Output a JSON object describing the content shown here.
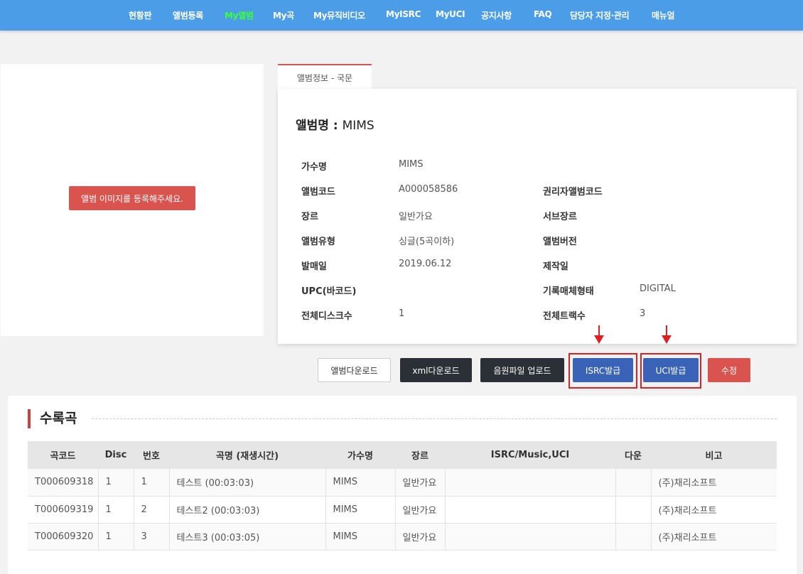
{
  "nav": [
    "현황판",
    "앨범등록",
    "My앨범",
    "My곡",
    "My뮤직비디오",
    "MyISRC",
    "MyUCI",
    "공지사항",
    "FAQ",
    "담당자 지정·관리",
    "매뉴얼"
  ],
  "nav_active": "My앨범",
  "image_panel": {
    "button": "앨범 이미지를 등록해주세요."
  },
  "tab_label": "앨범정보 - 국문",
  "album": {
    "title_label": "앨범명 : ",
    "title_value": "MIMS"
  },
  "info_rows": [
    {
      "l1": "가수명",
      "v1": "MIMS",
      "l2": "",
      "v2": ""
    },
    {
      "l1": "앨범코드",
      "v1": "A000058586",
      "l2": "권리자앨범코드",
      "v2": ""
    },
    {
      "l1": "장르",
      "v1": "일반가요",
      "l2": "서브장르",
      "v2": ""
    },
    {
      "l1": "앨범유형",
      "v1": "싱글(5곡이하)",
      "l2": "앨범버전",
      "v2": ""
    },
    {
      "l1": "발매일",
      "v1": "2019.06.12",
      "l2": "제작일",
      "v2": ""
    },
    {
      "l1": "UPC(바코드)",
      "v1": "",
      "l2": "기록매체형태",
      "v2": "DIGITAL"
    },
    {
      "l1": "전체디스크수",
      "v1": "1",
      "l2": "전체트랙수",
      "v2": "3"
    }
  ],
  "actions": {
    "album_download": "앨범다운로드",
    "xml_download": "xml다운로드",
    "audio_upload": "음원파일 업로드",
    "isrc": "ISRC발급",
    "uci": "UCI발급",
    "edit": "수정"
  },
  "tracks": {
    "title": "수록곡",
    "columns": [
      "곡코드",
      "Disc",
      "번호",
      "곡명 (재생시간)",
      "가수명",
      "장르",
      "ISRC/Music,UCI",
      "다운",
      "비고"
    ],
    "rows": [
      [
        "T000609318",
        "1",
        "1",
        "테스트 (00:03:03)",
        "MIMS",
        "일반가요",
        "",
        "",
        "(주)채리소프트"
      ],
      [
        "T000609319",
        "1",
        "2",
        "테스트2 (00:03:03)",
        "MIMS",
        "일반가요",
        "",
        "",
        "(주)채리소프트"
      ],
      [
        "T000609320",
        "1",
        "3",
        "테스트3 (00:03:05)",
        "MIMS",
        "일반가요",
        "",
        "",
        "(주)채리소프트"
      ]
    ]
  },
  "colors": {
    "nav_bg": "#4a9de6",
    "nav_active": "#3cff3c",
    "accent_red": "#d9534f",
    "button_blue": "#3a63b8",
    "button_dark": "#2b2f36",
    "highlight": "#e02020"
  }
}
